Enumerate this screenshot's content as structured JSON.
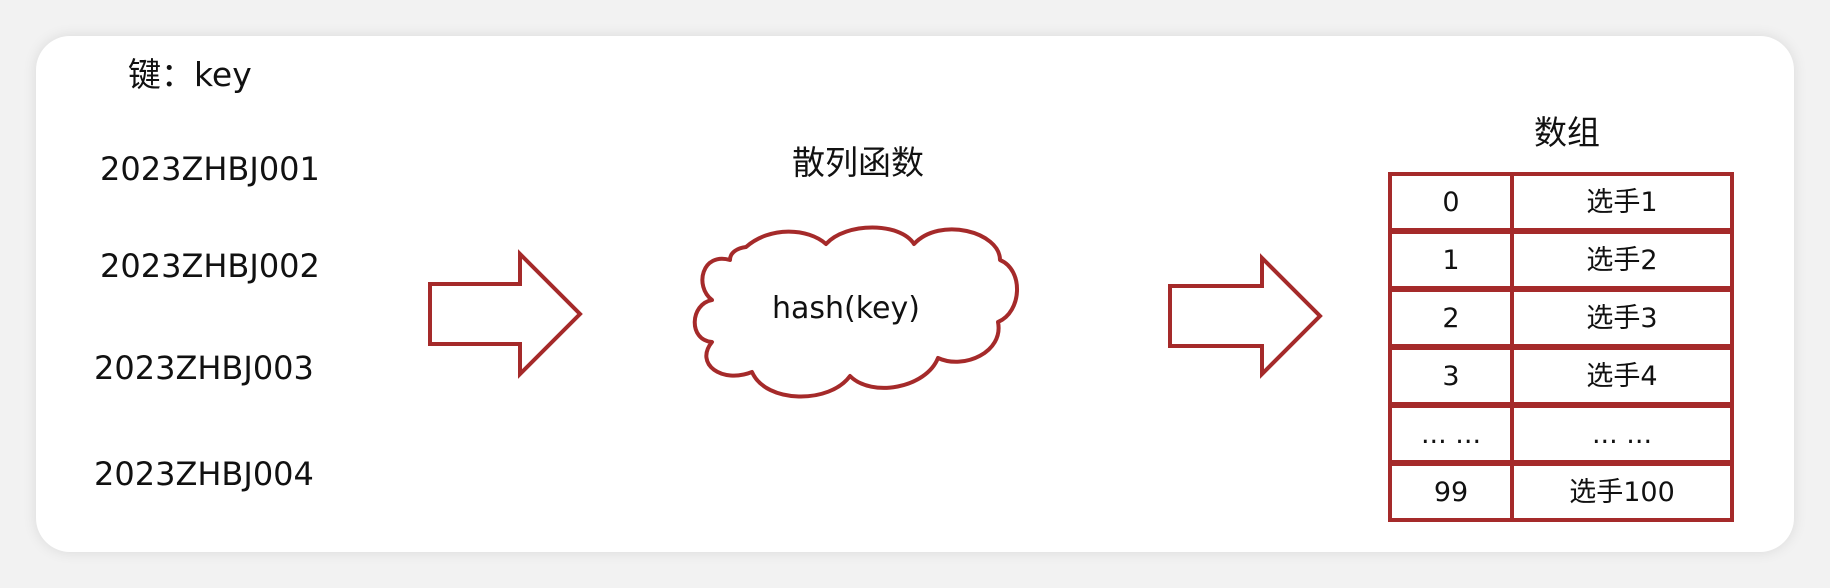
{
  "diagram": {
    "key_title": "键：key",
    "keys": [
      "2023ZHBJ001",
      "2023ZHBJ002",
      "2023ZHBJ003",
      "2023ZHBJ004"
    ],
    "hash_title": "散列函数",
    "hash_label": "hash(key)",
    "array_title": "数组",
    "array_rows": [
      {
        "index": "0",
        "value": "选手1"
      },
      {
        "index": "1",
        "value": "选手2"
      },
      {
        "index": "2",
        "value": "选手3"
      },
      {
        "index": "3",
        "value": "选手4"
      },
      {
        "index": "... ...",
        "value": "... ..."
      },
      {
        "index": "99",
        "value": "选手100"
      }
    ],
    "colors": {
      "accent": "#a52a2a",
      "text": "#111111",
      "card": "#ffffff",
      "background": "#f2f2f2"
    }
  }
}
